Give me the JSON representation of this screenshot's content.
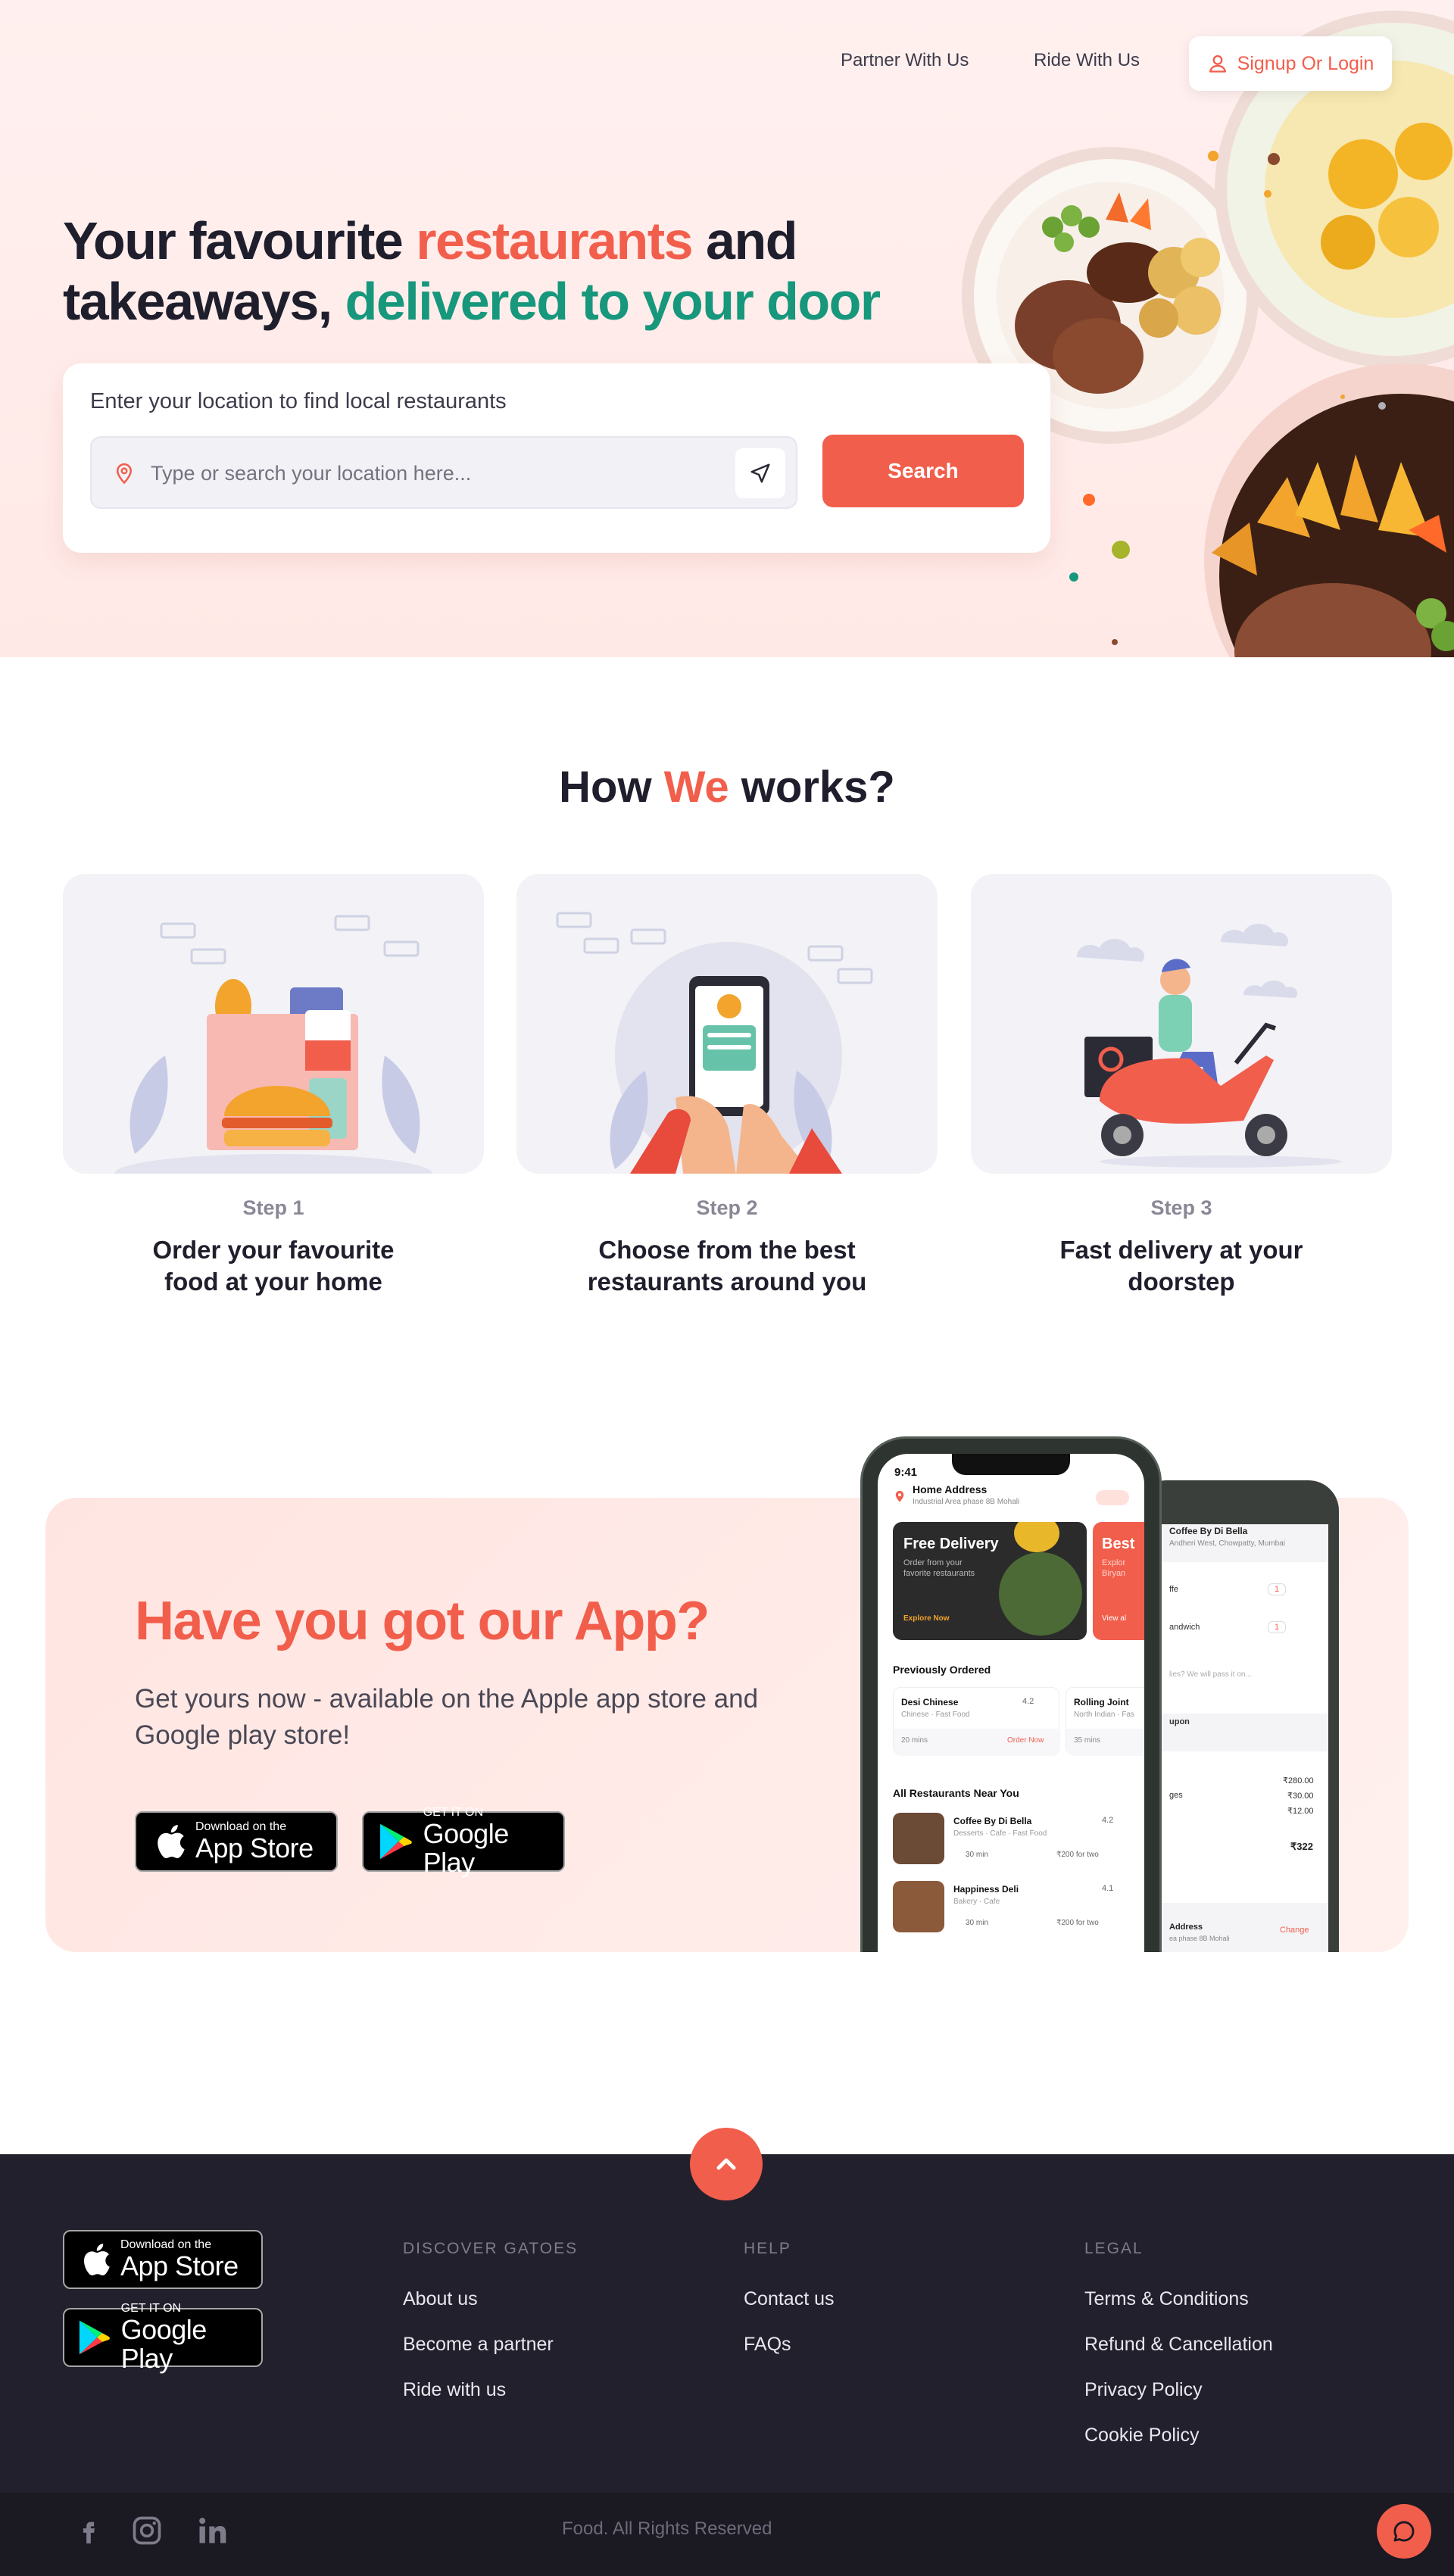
{
  "nav": {
    "partner": "Partner With Us",
    "ride": "Ride With Us",
    "signup": "Signup Or Login"
  },
  "hero": {
    "title_part1": "Your favourite ",
    "title_highlight1": "restaurants",
    "title_part2": " and",
    "title_part3": "takeaways, ",
    "title_highlight2": "delivered to your door",
    "search_label": "Enter your location to find local restaurants",
    "search_placeholder": "Type or search your location here...",
    "search_button": "Search"
  },
  "how": {
    "title_part1": "How ",
    "title_highlight": "We",
    "title_part2": " works?",
    "steps": [
      {
        "num": "Step 1",
        "line1": "Order your favourite",
        "line2": "food at your home"
      },
      {
        "num": "Step 2",
        "line1": "Choose from the best",
        "line2": "restaurants around you"
      },
      {
        "num": "Step 3",
        "line1": "Fast delivery at your",
        "line2": "doorstep"
      }
    ]
  },
  "app": {
    "title": "Have you got our App?",
    "subtitle": "Get yours now - available on the Apple app store and Google play store!",
    "appstore_small": "Download on the",
    "appstore_big": "App Store",
    "play_small": "GET IT ON",
    "play_big": "Google Play"
  },
  "phone_front": {
    "time": "9:41",
    "address_title": "Home Address",
    "address_sub": "Industrial Area phase 8B Mohali",
    "banner_title": "Free Delivery",
    "banner_sub1": "Order from your",
    "banner_sub2": "favorite restaurants",
    "banner_cta": "Explore Now",
    "banner2_title": "Best",
    "banner2_sub1": "Explor",
    "banner2_sub2": "Biryan",
    "banner2_cta": "View al",
    "prev_heading": "Previously Ordered",
    "prev1_name": "Desi Chinese",
    "prev1_rating": "4.2",
    "prev1_cuisine": "Chinese · Fast Food",
    "prev1_time": "20 mins",
    "prev1_cta": "Order Now",
    "prev2_name": "Rolling Joint",
    "prev2_cuisine": "North Indian · Fas",
    "prev2_time": "35 mins",
    "all_heading": "All Restaurants Near You",
    "r1_name": "Coffee By Di Bella",
    "r1_rating": "4.2",
    "r1_tags": "Desserts · Cafe · Fast Food",
    "r1_time": "30 min",
    "r1_price": "₹200 for two",
    "r2_name": "Happiness Deli",
    "r2_rating": "4.1",
    "r2_tags": "Bakery · Cafe",
    "r2_time": "30 min",
    "r2_price": "₹200 for two"
  },
  "phone_back": {
    "shop_name": "Coffee By Di Bella",
    "shop_addr": "Andheri West, Chowpatty, Mumbai",
    "item1": "ffe",
    "item1_qty": "1",
    "item2": "andwich",
    "item2_qty": "1",
    "note": "lies? We will pass it on...",
    "coupon": "upon",
    "price1": "₹280.00",
    "price2": "₹30.00",
    "price3": "₹12.00",
    "charges_label": "ges",
    "total": "₹322",
    "address_label": "Address",
    "address_sub": "ea phase 8B Mohali",
    "change": "Change"
  },
  "footer": {
    "col1_heading": "DISCOVER GATOES",
    "col1_links": [
      "About us",
      "Become a partner",
      "Ride with us"
    ],
    "col2_heading": "HELP",
    "col2_links": [
      "Contact us",
      "FAQs"
    ],
    "col3_heading": "LEGAL",
    "col3_links": [
      "Terms & Conditions",
      "Refund & Cancellation",
      "Privacy Policy",
      "Cookie Policy"
    ],
    "copyright": "Food. All Rights Reserved"
  },
  "colors": {
    "accent": "#f25e4c",
    "green": "#17977c",
    "dark": "#1f1e2c",
    "footer": "#22202c"
  }
}
